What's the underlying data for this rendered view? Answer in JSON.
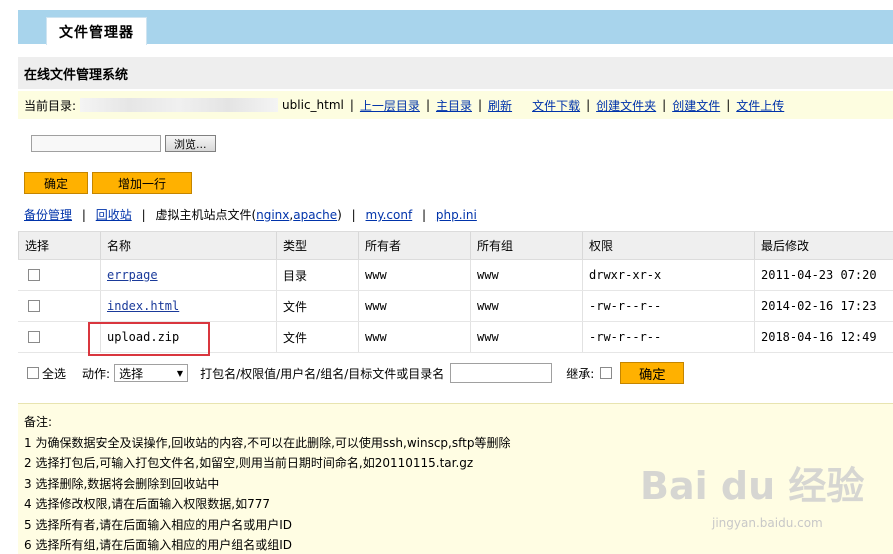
{
  "app": {
    "tab_title": "文件管理器",
    "section_title": "在线文件管理系统"
  },
  "path": {
    "label": "当前目录:",
    "dir_suffix": "ublic_html",
    "links": [
      "上一层目录",
      "主目录",
      "刷新",
      "文件下载",
      "创建文件夹",
      "创建文件",
      "文件上传"
    ]
  },
  "upload": {
    "browse_label": "浏览..."
  },
  "buttons": {
    "confirm": "确定",
    "add_row": "增加一行"
  },
  "links": {
    "backup": "备份管理",
    "recycle": "回收站",
    "vhost_prefix": "虚拟主机站点文件(",
    "nginx": "nginx",
    "comma": ",",
    "apache": "apache",
    "vhost_suffix": ")",
    "myconf": "my.conf",
    "phpini": "php.ini"
  },
  "table": {
    "headers": [
      "选择",
      "名称",
      "类型",
      "所有者",
      "所有组",
      "权限",
      "最后修改"
    ],
    "rows": [
      {
        "name": "errpage",
        "type": "目录",
        "owner": "www",
        "group": "www",
        "perm": "drwxr-xr-x",
        "modified": "2011-04-23 07:20"
      },
      {
        "name": "index.html",
        "type": "文件",
        "owner": "www",
        "group": "www",
        "perm": "-rw-r--r--",
        "modified": "2014-02-16 17:23"
      },
      {
        "name": "upload.zip",
        "type": "文件",
        "owner": "www",
        "group": "www",
        "perm": "-rw-r--r--",
        "modified": "2018-04-16 12:49"
      }
    ]
  },
  "actions": {
    "select_all": "全选",
    "action_label": "动作:",
    "action_value": "选择",
    "hint": "打包名/权限值/用户名/组名/目标文件或目录名",
    "inherit": "继承:",
    "ok": "确定"
  },
  "notes": {
    "title": "备注:",
    "lines": [
      "1 为确保数据安全及误操作,回收站的内容,不可以在此删除,可以使用ssh,winscp,sftp等删除",
      "2 选择打包后,可输入打包文件名,如留空,则用当前日期时间命名,如20110115.tar.gz",
      "3 选择删除,数据将会删除到回收站中",
      "4 选择修改权限,请在后面输入权限数据,如777",
      "5 选择所有者,请在后面输入相应的用户名或用户ID",
      "6 选择所有组,请在后面输入相应的用户组名或组ID"
    ]
  },
  "watermark": {
    "logo": "Bai du 经验",
    "url": "jingyan.baidu.com"
  }
}
